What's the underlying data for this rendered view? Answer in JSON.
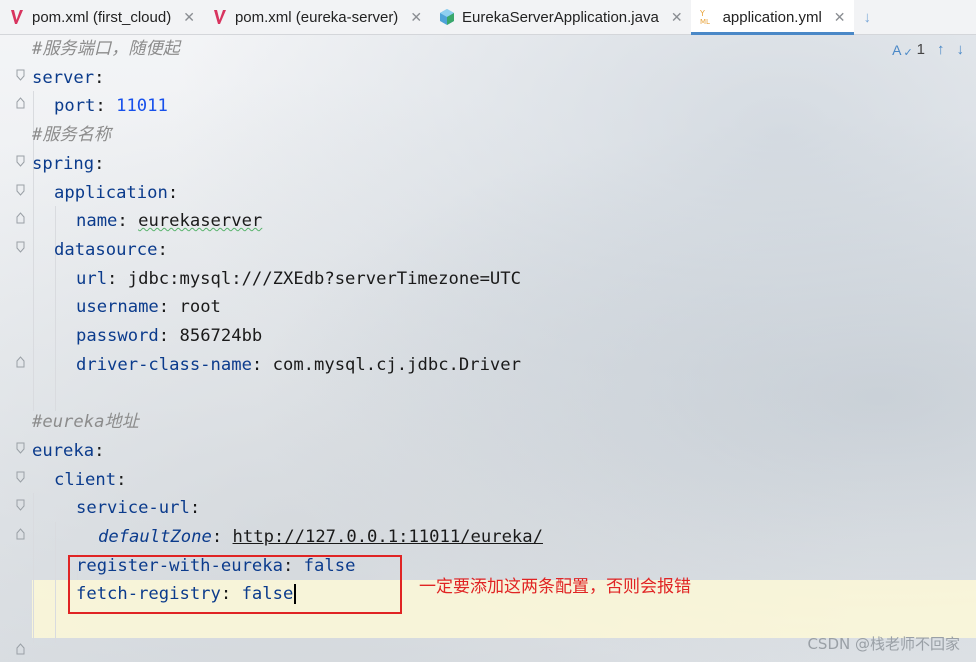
{
  "tabs": [
    {
      "label": "pom.xml (first_cloud)",
      "icon": "maven-icon",
      "active": false
    },
    {
      "label": "pom.xml (eureka-server)",
      "icon": "maven-icon",
      "active": false
    },
    {
      "label": "EurekaServerApplication.java",
      "icon": "java-class-icon",
      "active": false
    },
    {
      "label": "application.yml",
      "icon": "yaml-icon",
      "active": true
    }
  ],
  "inspection": {
    "count": "1",
    "icon": "typo-inspection-icon"
  },
  "code": {
    "l1": "#服务端口，随便起",
    "l2_key": "server",
    "l3_key": "port",
    "l3_val": "11011",
    "l4": "#服务名称",
    "l5_key": "spring",
    "l6_key": "application",
    "l7_key": "name",
    "l7_val": "eurekaserver",
    "l8_key": "datasource",
    "l9_key": "url",
    "l9_val": "jdbc:mysql:///ZXEdb?serverTimezone=UTC",
    "l10_key": "username",
    "l10_val": "root",
    "l11_key": "password",
    "l11_val": "856724bb",
    "l12_key": "driver-class-name",
    "l12_val": "com.mysql.cj.jdbc.Driver",
    "l14": "#eureka地址",
    "l15_key": "eureka",
    "l16_key": "client",
    "l17_key": "service-url",
    "l18_key": "defaultZone",
    "l18_val": "http://127.0.0.1:11011/eureka/",
    "l19_key": "register-with-eureka",
    "l19_val": "false",
    "l20_key": "fetch-registry",
    "l20_val": "false"
  },
  "annotation": "一定要添加这两条配置，否则会报错",
  "watermark": "CSDN @栈老师不回家",
  "colors": {
    "annotation": "#e02424",
    "key": "#0b3b8c",
    "accent": "#4a88c7"
  }
}
